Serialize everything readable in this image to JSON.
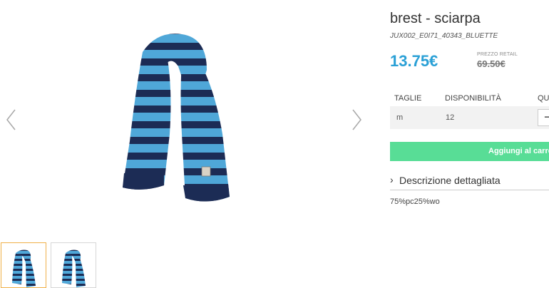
{
  "product": {
    "title": "brest - sciarpa",
    "sku": "JUX002_E0I71_40343_BLUETTE",
    "price": "13.75€",
    "retail_label": "PREZZO RETAIL",
    "retail_price": "69.50€"
  },
  "table": {
    "headers": {
      "size": "TAGLIE",
      "availability": "DISPONIBILITÀ",
      "quantity": "QU"
    },
    "rows": [
      {
        "size": "m",
        "availability": "12",
        "qty_symbol": "−"
      }
    ]
  },
  "cart_button": {
    "label": "Aggiungi al carrello"
  },
  "description": {
    "toggle_label": "Descrizione dettagliata",
    "text": "75%pc25%wo"
  },
  "icons": {
    "prev": "chevron-left-icon",
    "next": "chevron-right-icon",
    "toggle": "chevron-right-icon"
  },
  "colors": {
    "price": "#2aa0d6",
    "cart_button": "#58dd96",
    "active_thumb_border": "#f0b14a",
    "scarf_light": "#4fa7d8",
    "scarf_dark": "#1c2c55"
  }
}
